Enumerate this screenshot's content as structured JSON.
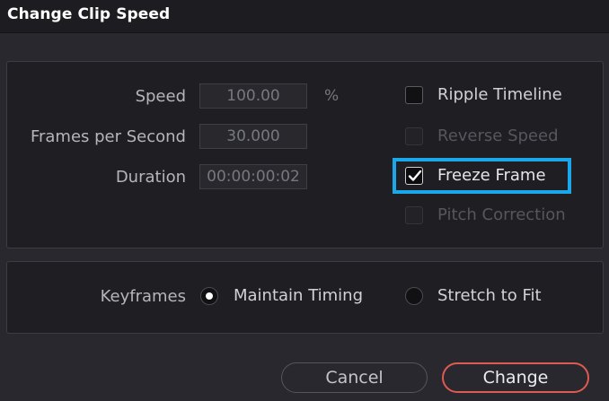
{
  "window": {
    "title": "Change Clip Speed"
  },
  "fields": {
    "speed": {
      "label": "Speed",
      "value": "100.00",
      "unit": "%"
    },
    "fps": {
      "label": "Frames per Second",
      "value": "30.000"
    },
    "duration": {
      "label": "Duration",
      "value": "00:00:00:02"
    }
  },
  "options": {
    "ripple_timeline": {
      "label": "Ripple Timeline",
      "checked": false,
      "enabled": true
    },
    "reverse_speed": {
      "label": "Reverse Speed",
      "checked": false,
      "enabled": false
    },
    "freeze_frame": {
      "label": "Freeze Frame",
      "checked": true,
      "enabled": true,
      "highlighted": true
    },
    "pitch_correction": {
      "label": "Pitch Correction",
      "checked": false,
      "enabled": false
    }
  },
  "keyframes": {
    "label": "Keyframes",
    "options": [
      {
        "label": "Maintain Timing",
        "selected": true
      },
      {
        "label": "Stretch to Fit",
        "selected": false
      }
    ]
  },
  "buttons": {
    "cancel": "Cancel",
    "change": "Change"
  },
  "colors": {
    "highlight": "#1aa8ea",
    "accent": "#e05a50"
  }
}
